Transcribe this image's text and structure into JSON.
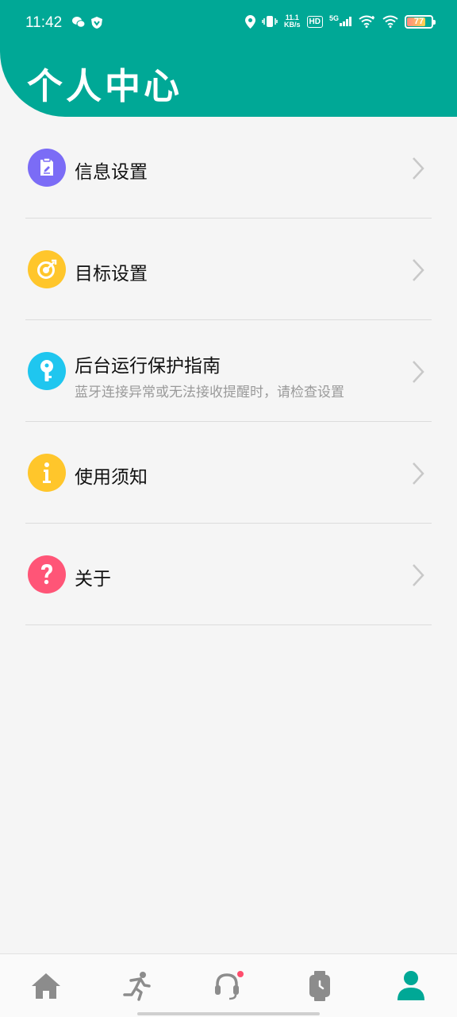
{
  "status_bar": {
    "time": "11:42",
    "net_speed_value": "11.1",
    "net_speed_unit": "KB/s",
    "hd": "HD",
    "network": "5G",
    "battery_level": "77"
  },
  "header": {
    "title": "个人中心"
  },
  "menu": {
    "items": [
      {
        "label": "信息设置",
        "icon": "edit-note-icon",
        "color": "#7b6cf6"
      },
      {
        "label": "目标设置",
        "icon": "target-icon",
        "color": "#ffc62b"
      },
      {
        "label": "后台运行保护指南",
        "subtitle": "蓝牙连接异常或无法接收提醒时，请检查设置",
        "icon": "key-icon",
        "color": "#1fc6ef"
      },
      {
        "label": "使用须知",
        "icon": "info-icon",
        "color": "#ffc62b"
      },
      {
        "label": "关于",
        "icon": "question-icon",
        "color": "#ff5577"
      }
    ]
  },
  "bottom_nav": {
    "items": [
      {
        "icon": "home-icon",
        "active": false
      },
      {
        "icon": "running-icon",
        "active": false
      },
      {
        "icon": "headset-icon",
        "active": false,
        "badge": true
      },
      {
        "icon": "watch-icon",
        "active": false
      },
      {
        "icon": "person-icon",
        "active": true
      }
    ],
    "active_color": "#00a896",
    "inactive_color": "#8c8c8c"
  }
}
